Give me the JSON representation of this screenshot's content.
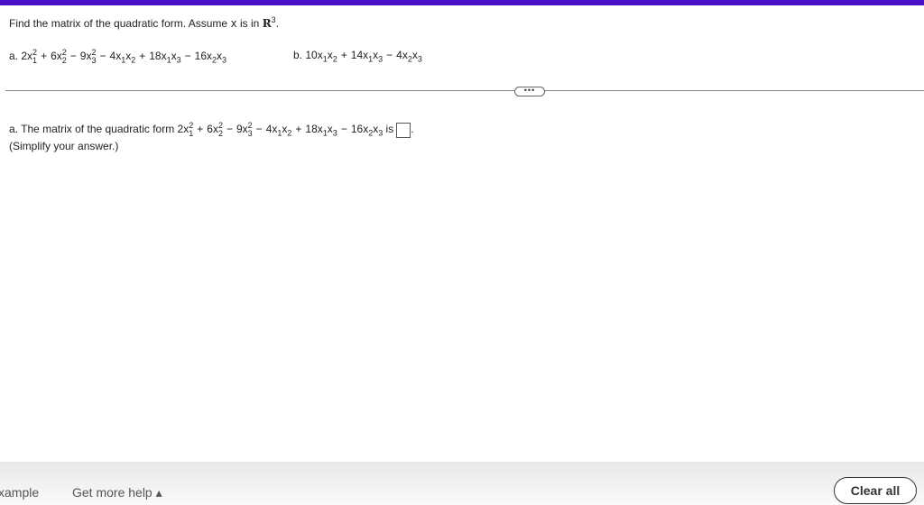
{
  "colors": {
    "topbar": "#4b0fc8"
  },
  "question": {
    "title_pre": "Find the matrix of the quadratic form. Assume ",
    "title_var": "x",
    "title_mid": " is in ",
    "title_set": "R",
    "title_exp": "3",
    "title_end": ".",
    "a_label": "a.",
    "b_label": "b.",
    "expr_a": [
      {
        "sign": "",
        "coef": "2",
        "vars": [
          {
            "v": "x",
            "sub": "1",
            "sup": "2"
          }
        ]
      },
      {
        "sign": "+",
        "coef": "6",
        "vars": [
          {
            "v": "x",
            "sub": "2",
            "sup": "2"
          }
        ]
      },
      {
        "sign": "−",
        "coef": "9",
        "vars": [
          {
            "v": "x",
            "sub": "3",
            "sup": "2"
          }
        ]
      },
      {
        "sign": "−",
        "coef": "4",
        "vars": [
          {
            "v": "x",
            "sub": "1"
          },
          {
            "v": "x",
            "sub": "2"
          }
        ]
      },
      {
        "sign": "+",
        "coef": "18",
        "vars": [
          {
            "v": "x",
            "sub": "1"
          },
          {
            "v": "x",
            "sub": "3"
          }
        ]
      },
      {
        "sign": "−",
        "coef": "16",
        "vars": [
          {
            "v": "x",
            "sub": "2"
          },
          {
            "v": "x",
            "sub": "3"
          }
        ]
      }
    ],
    "expr_b": [
      {
        "sign": "",
        "coef": "10",
        "vars": [
          {
            "v": "x",
            "sub": "1"
          },
          {
            "v": "x",
            "sub": "2"
          }
        ]
      },
      {
        "sign": "+",
        "coef": "14",
        "vars": [
          {
            "v": "x",
            "sub": "1"
          },
          {
            "v": "x",
            "sub": "3"
          }
        ]
      },
      {
        "sign": "−",
        "coef": "4",
        "vars": [
          {
            "v": "x",
            "sub": "2"
          },
          {
            "v": "x",
            "sub": "3"
          }
        ]
      }
    ]
  },
  "more_button": "•••",
  "answer": {
    "prefix": "a. The matrix of the quadratic form ",
    "suffix": " is",
    "end": ".",
    "hint": "(Simplify your answer.)"
  },
  "footer": {
    "example": "xample",
    "help": "Get more help ▴",
    "clear": "Clear all"
  }
}
